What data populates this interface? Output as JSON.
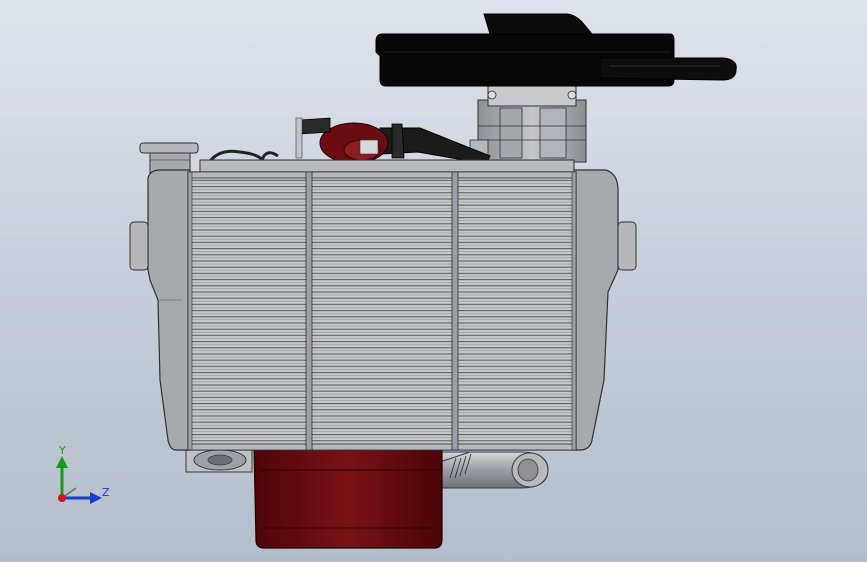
{
  "viewport": {
    "background_top": "#dfe3ea",
    "background_bottom": "#b4bdcb"
  },
  "model": {
    "description_icon": "engine-assembly-front-view",
    "colors": {
      "radiator_frame": "#a7aaad",
      "radiator_fins": "#c6c8ca",
      "fin_line": "#5f6266",
      "air_filter": "#050505",
      "oil_pan": "#6a0a0e",
      "intake_red": "#7a1014",
      "pipe_dark": "#1b1b1b",
      "metal": "#b9bbbe"
    }
  },
  "triad": {
    "y_label": "Y",
    "z_label": "Z",
    "y_color": "#1a9a1a",
    "z_color": "#1a3cc8",
    "origin_color": "#c81a1a"
  }
}
